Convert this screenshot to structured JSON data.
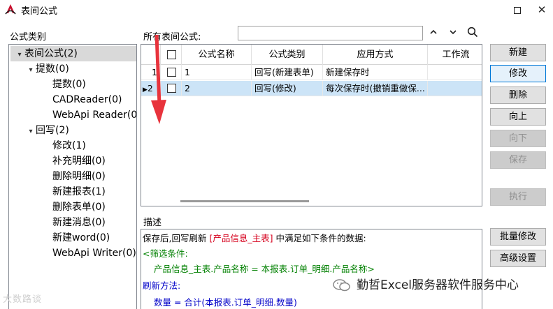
{
  "window": {
    "title": "表间公式",
    "maximize_glyph": "",
    "close_glyph": "✕"
  },
  "left": {
    "category_label": "公式类别",
    "tree": [
      {
        "label": "表间公式(2)",
        "level": 0,
        "expanded": true,
        "selected": true
      },
      {
        "label": "提数(0)",
        "level": 1,
        "expanded": true
      },
      {
        "label": "提数(0)",
        "level": 2
      },
      {
        "label": "CADReader(0)",
        "level": 2
      },
      {
        "label": "WebApi Reader(0",
        "level": 2
      },
      {
        "label": "回写(2)",
        "level": 1,
        "expanded": true
      },
      {
        "label": "修改(1)",
        "level": 2
      },
      {
        "label": "补充明细(0)",
        "level": 2
      },
      {
        "label": "删除明细(0)",
        "level": 2
      },
      {
        "label": "新建报表(1)",
        "level": 2
      },
      {
        "label": "删除表单(0)",
        "level": 2
      },
      {
        "label": "新建消息(0)",
        "level": 2
      },
      {
        "label": "新建word(0)",
        "level": 2
      },
      {
        "label": "WebApi Writer(0)",
        "level": 2
      }
    ]
  },
  "formulas": {
    "label": "所有表间公式:",
    "search_value": "",
    "nav": {
      "up": "⌃",
      "down": "⌄",
      "search": "⚲"
    },
    "columns": [
      "",
      "公式名称",
      "公式类别",
      "应用方式",
      "工作流"
    ],
    "rows": [
      {
        "index": "1",
        "marker": "",
        "name": "1",
        "category": "回写(新建表单)",
        "mode": "新建保存时",
        "flow": "",
        "selected": false
      },
      {
        "index": "2",
        "marker": "▶",
        "name": "2",
        "category": "回写(修改)",
        "mode": "每次保存时(撤销重做保...",
        "flow": "",
        "selected": true
      }
    ]
  },
  "buttons": {
    "new": "新建",
    "edit": "修改",
    "delete": "删除",
    "up": "向上",
    "down": "向下",
    "save": "保存",
    "execute": "执行",
    "batch_edit": "批量修改",
    "advanced": "高级设置"
  },
  "description": {
    "label": "描述",
    "line1_prefix": "保存后,回写刷新",
    "line1_highlight": "[产品信息_主表]",
    "line1_suffix": "中满足如下条件的数据:",
    "filter_label": "<筛选条件:",
    "filter_expr": "产品信息_主表.产品名称 = 本报表.订单_明细.产品名称>",
    "refresh_label": "刷新方法:",
    "refresh_expr": "数量 = 合计(本报表.订单_明细.数量)"
  },
  "watermarks": {
    "left": "大数路谈",
    "right": "勤哲Excel服务器软件服务中心"
  },
  "colors": {
    "highlight_red": "#d6001c",
    "green": "#008000",
    "blue": "#0000c8",
    "selection": "#cce4f7",
    "arrow": "#e8333c"
  }
}
